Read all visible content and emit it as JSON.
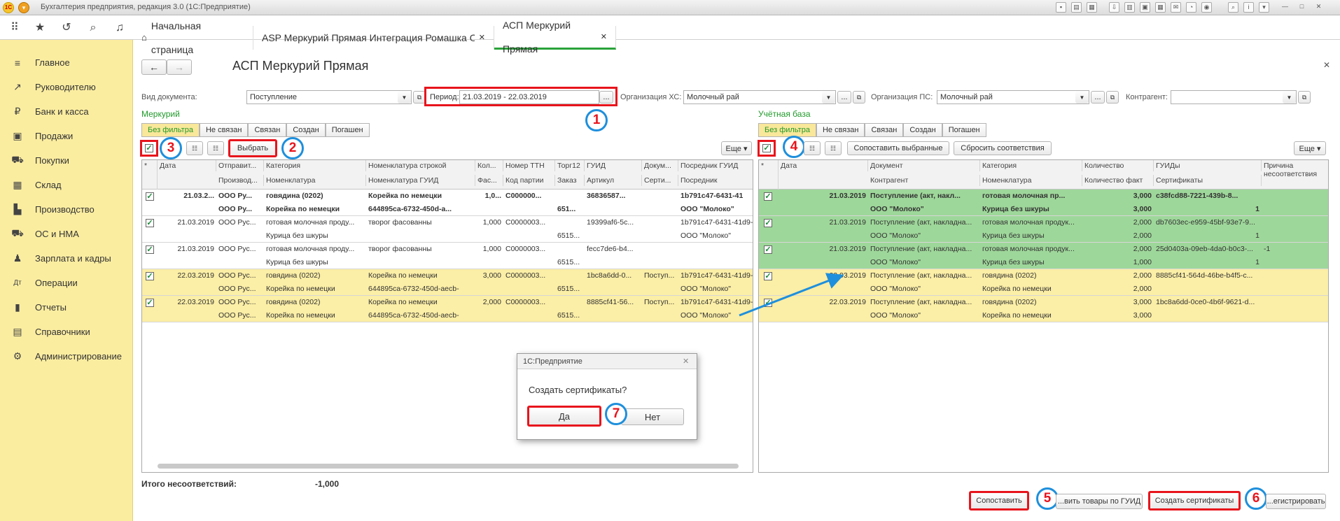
{
  "app": {
    "title": "Бухгалтерия предприятия, редакция 3.0 (1С:Предприятие)"
  },
  "tabs": [
    {
      "label": "Начальная страница"
    },
    {
      "label": "ASP Меркурий Прямая Интеграция Ромашка ООО"
    },
    {
      "label": "АСП Меркурий Прямая"
    }
  ],
  "sidebar": {
    "items": [
      "Главное",
      "Руководителю",
      "Банк и касса",
      "Продажи",
      "Покупки",
      "Склад",
      "Производство",
      "ОС и НМА",
      "Зарплата и кадры",
      "Операции",
      "Отчеты",
      "Справочники",
      "Администрирование"
    ]
  },
  "page": {
    "title": "АСП Меркурий Прямая"
  },
  "filters": {
    "doc_type_label": "Вид документа:",
    "doc_type_value": "Поступление",
    "period_label": "Период:",
    "period_value": "21.03.2019 - 22.03.2019",
    "org_hs_label": "Организация ХС:",
    "org_hs_value": "Молочный рай",
    "org_ps_label": "Организация ПС:",
    "org_ps_value": "Молочный рай",
    "counterparty_label": "Контрагент:",
    "counterparty_value": "",
    "ellipsis": "...",
    "more": "Еще ▾"
  },
  "mercury": {
    "title": "Меркурий",
    "filter_tabs": [
      "Без фильтра",
      "Не связан",
      "Связан",
      "Создан",
      "Погашен"
    ],
    "select_btn": "Выбрать",
    "headers_top": [
      "Дата",
      "Отправит...",
      "Категория",
      "Номенклатура строкой",
      "Кол...",
      "Номер ТТН",
      "Торг12",
      "ГУИД",
      "Докум...",
      "Посредник ГУИД"
    ],
    "headers_bottom": [
      "",
      "Производ...",
      "Номенклатура",
      "Номенклатура ГУИД",
      "Фас...",
      "Код партии",
      "Заказ",
      "Артикул",
      "Серти...",
      "Посредник"
    ],
    "rows": [
      {
        "c1": [
          "21.03.2...",
          "ООО Ру...",
          "говядина (0202)",
          "Корейка по немецки",
          "1,0...",
          "С000000...",
          "",
          "36836587...",
          "",
          "1b791c47-6431-41"
        ],
        "c2": [
          "",
          "ООО Ру...",
          "Корейка по немецки",
          "644895ca-6732-450d-a...",
          "",
          "",
          "651...",
          "",
          "",
          "ООО \"Молоко\""
        ]
      },
      {
        "c1": [
          "21.03.2019",
          "ООО Рус...",
          "готовая молочная проду...",
          "творог фасованны",
          "1,000",
          "С0000003...",
          "",
          "19399af6-5c...",
          "",
          "1b791c47-6431-41d9-"
        ],
        "c2": [
          "",
          "",
          "Курица без шкуры",
          "",
          "",
          "",
          "6515...",
          "",
          "",
          "ООО \"Молоко\""
        ]
      },
      {
        "c1": [
          "21.03.2019",
          "ООО Рус...",
          "готовая молочная проду...",
          "творог фасованны",
          "1,000",
          "С0000003...",
          "",
          "fecc7de6-b4...",
          "",
          ""
        ],
        "c2": [
          "",
          "",
          "Курица без шкуры",
          "",
          "",
          "",
          "6515...",
          "",
          "",
          ""
        ]
      },
      {
        "c1": [
          "22.03.2019",
          "ООО Рус...",
          "говядина (0202)",
          "Корейка по немецки",
          "3,000",
          "С0000003...",
          "",
          "1bc8a6dd-0...",
          "Поступ...",
          "1b791c47-6431-41d9-"
        ],
        "c2": [
          "",
          "ООО Рус...",
          "Корейка по немецки",
          "644895ca-6732-450d-aecb-",
          "",
          "",
          "6515...",
          "",
          "",
          "ООО \"Молоко\""
        ]
      },
      {
        "c1": [
          "22.03.2019",
          "ООО Рус...",
          "говядина (0202)",
          "Корейка по немецки",
          "2,000",
          "С0000003...",
          "",
          "8885cf41-56...",
          "Поступ...",
          "1b791c47-6431-41d9-"
        ],
        "c2": [
          "",
          "ООО Рус...",
          "Корейка по немецки",
          "644895ca-6732-450d-aecb-",
          "",
          "",
          "6515...",
          "",
          "",
          "ООО \"Молоко\""
        ]
      }
    ],
    "total_label": "Итого несоответствий:",
    "total_value": "-1,000"
  },
  "base": {
    "title": "Учётная база",
    "filter_tabs": [
      "Без фильтра",
      "Не связан",
      "Связан",
      "Создан",
      "Погашен"
    ],
    "match_selected": "Сопоставить выбранные",
    "reset_match": "Сбросить соответствия",
    "headers_top": [
      "Дата",
      "Документ",
      "Категория",
      "Количество",
      "ГУИДы",
      "Причина несоответствия"
    ],
    "headers_bottom": [
      "",
      "Контрагент",
      "Номенклатура",
      "Количество факт",
      "Сертификаты",
      ""
    ],
    "rows": [
      {
        "c1": [
          "21.03.2019",
          "Поступление (акт, накл...",
          "готовая молочная пр...",
          "3,000",
          "c38fcd88-7221-439b-8...",
          ""
        ],
        "c2": [
          "",
          "ООО \"Молоко\"",
          "Курица без шкуры",
          "3,000",
          "1",
          ""
        ]
      },
      {
        "c1": [
          "21.03.2019",
          "Поступление (акт, накладна...",
          "готовая молочная продук...",
          "2,000",
          "db7603ec-e959-45bf-93e7-9...",
          ""
        ],
        "c2": [
          "",
          "ООО \"Молоко\"",
          "Курица без шкуры",
          "2,000",
          "1",
          ""
        ]
      },
      {
        "c1": [
          "21.03.2019",
          "Поступление (акт, накладна...",
          "готовая молочная продук...",
          "2,000",
          "25d0403a-09eb-4da0-b0c3-...",
          "-1"
        ],
        "c2": [
          "",
          "ООО \"Молоко\"",
          "Курица без шкуры",
          "1,000",
          "1",
          ""
        ]
      },
      {
        "c1": [
          "22.03.2019",
          "Поступление (акт, накладна...",
          "говядина (0202)",
          "2,000",
          "8885cf41-564d-46be-b4f5-c...",
          ""
        ],
        "c2": [
          "",
          "ООО \"Молоко\"",
          "Корейка по немецки",
          "2,000",
          "",
          ""
        ]
      },
      {
        "c1": [
          "22.03.2019",
          "Поступление (акт, накладна...",
          "говядина (0202)",
          "3,000",
          "1bc8a6dd-0ce0-4b6f-9621-d...",
          ""
        ],
        "c2": [
          "",
          "ООО \"Молоко\"",
          "Корейка по немецки",
          "3,000",
          "",
          ""
        ]
      }
    ]
  },
  "dialog": {
    "title": "1С:Предприятие",
    "message": "Создать сертификаты?",
    "yes": "Да",
    "no": "Нет"
  },
  "footer": {
    "match_btn": "Сопоставить",
    "load_guid_btn": "...вить товары по ГУИД",
    "create_cert_btn": "Создать сертификаты",
    "register_btn": "...егистрировать"
  },
  "callouts": [
    "1",
    "2",
    "3",
    "4",
    "5",
    "6",
    "7"
  ],
  "colors": {
    "sidebar": "#fbeda0",
    "matched": "#9ed79a",
    "pending": "#fbeea6",
    "callout_red": "#e8141c",
    "callout_blue": "#1e8fdc"
  }
}
